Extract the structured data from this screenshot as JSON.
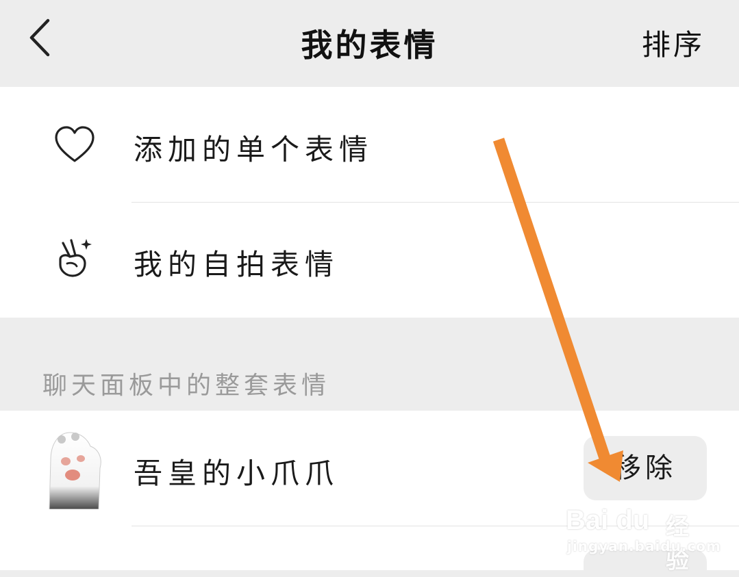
{
  "nav": {
    "title": "我的表情",
    "sort_label": "排序"
  },
  "items": [
    {
      "label": "添加的单个表情",
      "icon": "heart-icon"
    },
    {
      "label": "我的自拍表情",
      "icon": "peace-hand-icon"
    }
  ],
  "section": {
    "header": "聊天面板中的整套表情"
  },
  "packs": [
    {
      "name": "吾皇的小爪爪",
      "action": "移除",
      "icon": "cat-paw-sticker"
    }
  ],
  "watermark": {
    "logo": "Bai du",
    "text": "经验",
    "url": "jingyan.baidu.com"
  },
  "colors": {
    "annotation_arrow": "#f08a32",
    "background": "#ededed",
    "surface": "#ffffff"
  }
}
